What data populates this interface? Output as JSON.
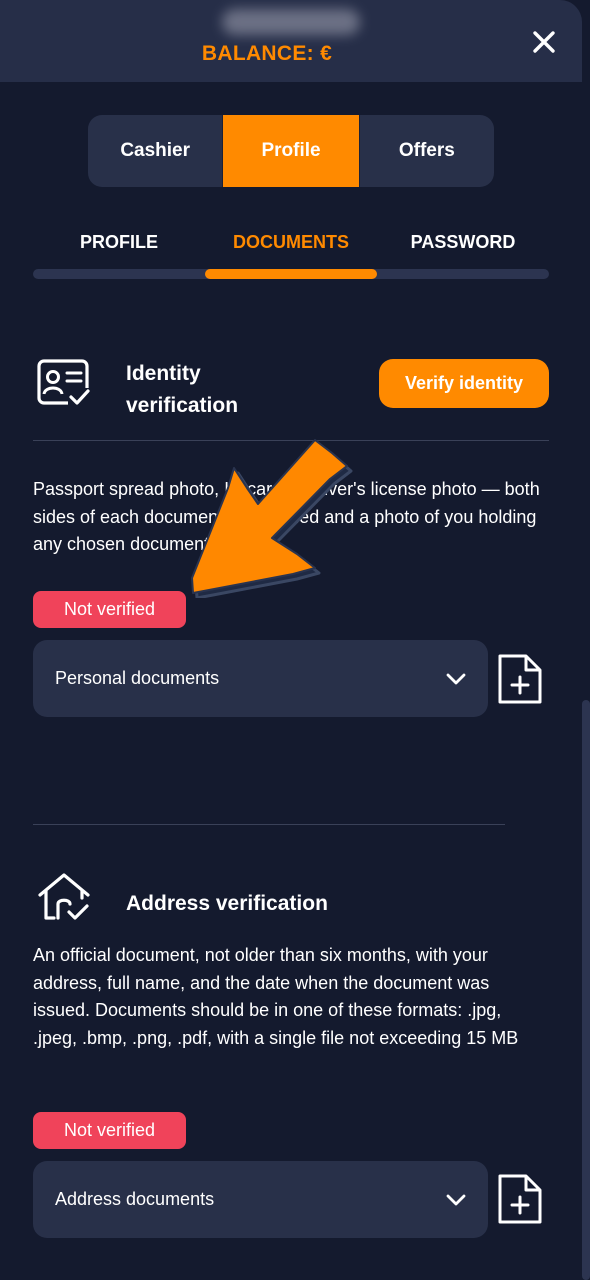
{
  "header": {
    "balance_label": "BALANCE: €"
  },
  "main_tabs": [
    {
      "label": "Cashier",
      "active": false
    },
    {
      "label": "Profile",
      "active": true
    },
    {
      "label": "Offers",
      "active": false
    }
  ],
  "sub_tabs": [
    {
      "label": "PROFILE",
      "active": false
    },
    {
      "label": "DOCUMENTS",
      "active": true
    },
    {
      "label": "PASSWORD",
      "active": false
    }
  ],
  "identity": {
    "title_line1": "Identity",
    "title_line2": "verification",
    "verify_button": "Verify identity",
    "description": "Passport spread photo, ID card or driver's license photo — both sides of each document are needed and a photo of you holding any chosen document",
    "status": "Not verified",
    "select_value": "Personal documents"
  },
  "address": {
    "title": "Address verification",
    "description": "An official document, not older than six months, with your address, full name, and the date when the document was issued. Documents should be in one of these formats: .jpg, .jpeg, .bmp, .png, .pdf, with a single file not exceeding 15 MB",
    "status": "Not verified",
    "select_value": "Address documents"
  },
  "colors": {
    "accent": "#ff8a00",
    "background": "#141a2e",
    "panel": "#283049",
    "status_red": "#f0435a"
  },
  "icons": [
    "close-icon",
    "id-card-check-icon",
    "chevron-down-icon",
    "file-plus-icon",
    "home-check-icon",
    "annotation-arrow-icon"
  ]
}
